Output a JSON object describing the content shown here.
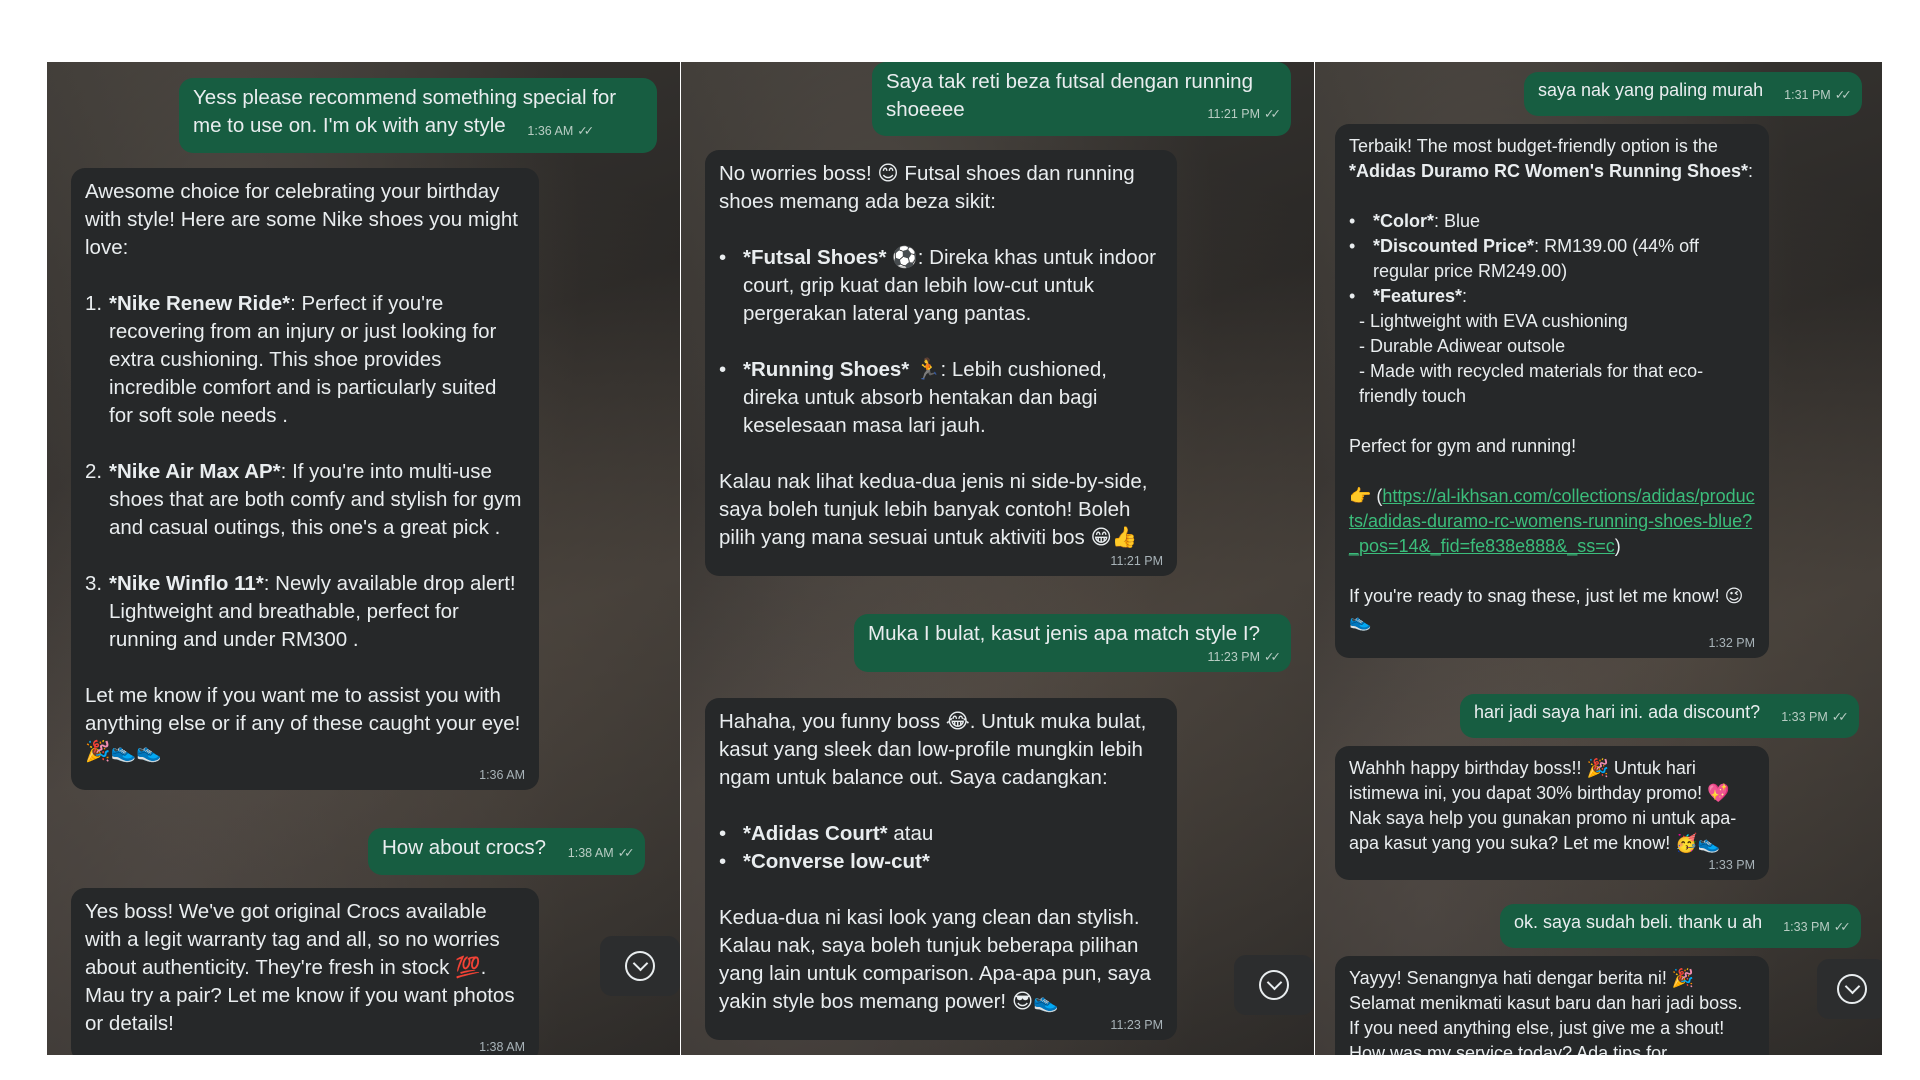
{
  "panel1": {
    "m1": {
      "text": "Yess please recommend something special for me to use on. I'm ok with any style",
      "time": "1:36 AM"
    },
    "m2": {
      "intro": "Awesome choice for celebrating your birthday with style! Here are some Nike shoes you might love:",
      "items": [
        {
          "num": "1.",
          "title": "*Nike Renew Ride*",
          "desc": ": Perfect if you're recovering from an injury or just looking for extra cushioning. This shoe provides incredible comfort and is particularly suited for soft sole needs ."
        },
        {
          "num": "2.",
          "title": "*Nike Air Max AP*",
          "desc": ": If you're into multi-use shoes that are both comfy and stylish for gym and casual outings, this one's a great pick  ."
        },
        {
          "num": "3.",
          "title": "*Nike Winflo 11*",
          "desc": ": Newly available drop alert! Lightweight and breathable, perfect for running and under RM300 ."
        }
      ],
      "outro": "Let me know if you want me to assist you with anything else or if any of these caught your eye! 🎉👟👟",
      "time": "1:36 AM"
    },
    "m3": {
      "text": "How about crocs?",
      "time": "1:38 AM"
    },
    "m4": {
      "text": "Yes boss! We've got original Crocs available with a legit warranty tag and all, so no worries about authenticity. They're fresh in stock 💯. Mau try a pair? Let me know if you want photos or details!",
      "time": "1:38 AM"
    }
  },
  "panel2": {
    "m1": {
      "text": "Saya tak reti beza futsal dengan running shoeeee",
      "time": "11:21 PM"
    },
    "m2": {
      "intro": "No worries boss! 😊 Futsal shoes dan running shoes memang ada beza sikit:",
      "items": [
        {
          "title": "*Futsal Shoes*",
          "desc": " ⚽: Direka khas untuk indoor court, grip kuat dan lebih low-cut untuk pergerakan lateral yang pantas."
        },
        {
          "title": "*Running Shoes*",
          "desc": " 🏃: Lebih cushioned, direka untuk absorb hentakan dan bagi keselesaan masa lari jauh."
        }
      ],
      "outro": "Kalau nak lihat kedua-dua jenis ni side-by-side, saya boleh tunjuk lebih banyak contoh! Boleh pilih yang mana sesuai untuk aktiviti bos 😁👍",
      "time": "11:21 PM"
    },
    "m3": {
      "text": "Muka I bulat, kasut jenis apa match style I?",
      "time": "11:23 PM"
    },
    "m4": {
      "intro": "Hahaha, you funny boss 😂. Untuk muka bulat, kasut yang sleek dan low-profile mungkin lebih ngam untuk balance out. Saya cadangkan:",
      "items": [
        {
          "title": "*Adidas Court*",
          "desc": " atau"
        },
        {
          "title": "*Converse low-cut*",
          "desc": ""
        }
      ],
      "outro": "Kedua-dua ni kasi look yang clean dan stylish. Kalau nak, saya boleh tunjuk beberapa pilihan yang lain untuk comparison. Apa-apa pun, saya yakin style bos memang power! 😎👟",
      "time": "11:23 PM"
    }
  },
  "panel3": {
    "m1": {
      "text": "saya nak yang paling murah",
      "time": "1:31 PM"
    },
    "m2": {
      "intro_a": "Terbaik! The most budget-friendly option is the ",
      "intro_b": "*Adidas Duramo RC Women's Running Shoes*",
      "intro_c": ":",
      "items": [
        {
          "title": "*Color*",
          "desc": ": Blue"
        },
        {
          "title": "*Discounted Price*",
          "desc": ": RM139.00 (44% off regular price RM249.00)"
        },
        {
          "title": "*Features*",
          "desc": ":"
        }
      ],
      "features": [
        "- Lightweight with EVA cushioning",
        "- Durable Adiwear outsole",
        "- Made with recycled materials for that eco-friendly touch"
      ],
      "perfect": "Perfect for gym and running!",
      "link_prefix": "👉 (",
      "link": "https://al-ikhsan.com/collections/adidas/products/adidas-duramo-rc-womens-running-shoes-blue?_pos=14&_fid=fe838e888&_ss=c",
      "link_suffix": ")",
      "outro": "If you're ready to snag these, just let me know! 😉👟",
      "time": "1:32 PM"
    },
    "m3": {
      "text": "hari jadi saya hari ini. ada discount?",
      "time": "1:33 PM"
    },
    "m4": {
      "text": "Wahhh happy birthday boss!! 🎉 Untuk hari istimewa ini, you dapat 30% birthday promo! 💖 Nak saya help you gunakan promo ni untuk apa-apa kasut yang you suka? Let me know! 🥳👟",
      "time": "1:33 PM"
    },
    "m5": {
      "text": "ok. saya sudah beli. thank u ah",
      "time": "1:33 PM"
    },
    "m6": {
      "text": "Yayyy! Senangnya hati dengar berita ni! 🎉 Selamat menikmati kasut baru dan hari jadi boss. If you need anything else, just give me a shout! How was my service today? Ada tips for"
    }
  },
  "icons": {
    "read": "double-check-icon",
    "scroll": "chevron-down-icon"
  }
}
